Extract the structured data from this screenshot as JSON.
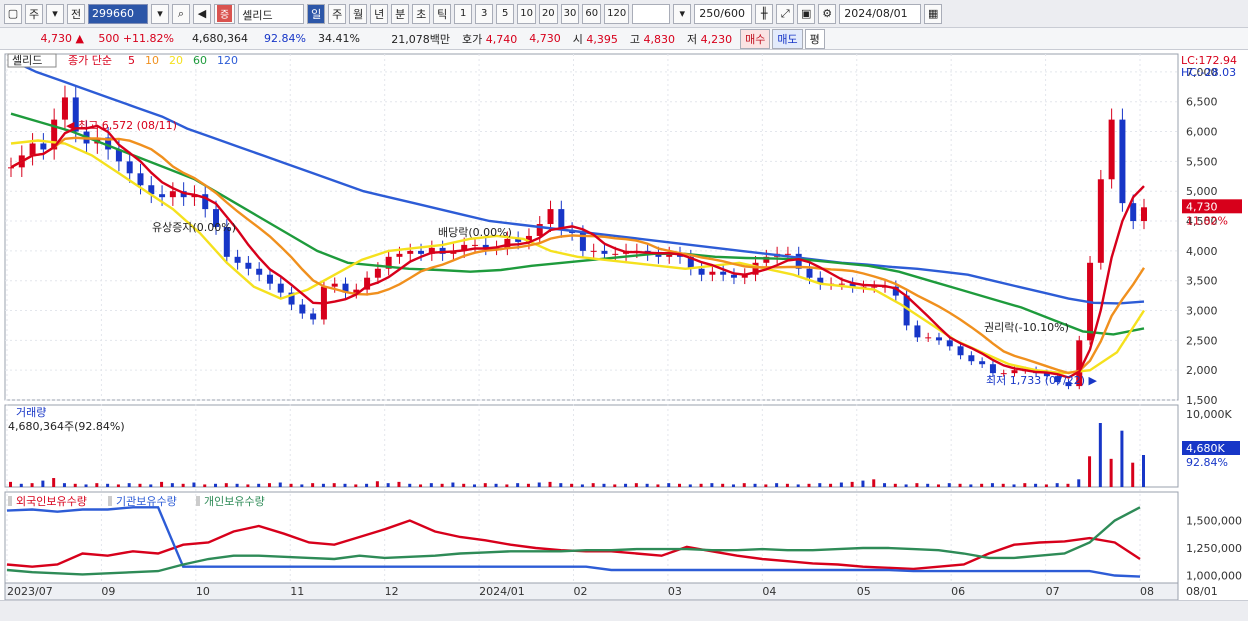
{
  "toolbar": {
    "type_label": "주",
    "prev_label": "전",
    "code": "299660",
    "tag": "증",
    "name": "셀리드",
    "periods": [
      "일",
      "주",
      "월",
      "년",
      "분",
      "초",
      "틱"
    ],
    "active_period": "일",
    "intervals": [
      "1",
      "3",
      "5",
      "10",
      "20",
      "30",
      "60",
      "120"
    ],
    "count": "250",
    "total": "/600",
    "date": "2024/08/01"
  },
  "quote": {
    "price": "4,730",
    "arrow": "▲",
    "change": "500",
    "change_pct": "+11.82%",
    "volume": "4,680,364",
    "vol_ratio": "92.84%",
    "turnover": "34.41%",
    "amount": "21,078백만",
    "ask_label": "호가",
    "ask": "4,740",
    "bid": "4,730",
    "open_label": "시",
    "open": "4,395",
    "high_label": "고",
    "high": "4,830",
    "low_label": "저",
    "low": "4,230",
    "buy_label": "매수",
    "sell_label": "매도",
    "eval_label": "평"
  },
  "legend": {
    "name": "셀리드",
    "close_label": "종가 단순",
    "ma_labels": [
      "5",
      "10",
      "20",
      "60",
      "120"
    ],
    "ma_colors": [
      "#d7001b",
      "#f0901e",
      "#f5e11e",
      "#1e9b3c",
      "#2d5cd6"
    ]
  },
  "right_header": {
    "lc": "LC:172.94",
    "hc": "HC:-28.03"
  },
  "price_badge": {
    "price": "4,730",
    "pct": "11.82%"
  },
  "annotations": {
    "high": "최고 6,572 (08/11)",
    "rights": "유상증자(0.00%)",
    "dividend": "배당락(0.00%)",
    "rights2": "권리락(-10.10%)",
    "low": "최저 1,733 (07/22)"
  },
  "volume_panel": {
    "title": "거래량",
    "value": "4,680,364주(92.84%)",
    "axis_label": "10,000K",
    "badge": "4,680K",
    "badge_pct": "92.84%"
  },
  "holdings_panel": {
    "labels": [
      "외국인보유수량",
      "기관보유수량",
      "개인보유수량"
    ],
    "colors": [
      "#d7001b",
      "#2d5cd6",
      "#2e8b57"
    ],
    "axis_labels": [
      "1,500,000",
      "1,250,000",
      "1,000,000"
    ]
  },
  "chart_data": {
    "type": "candlestick",
    "ylim": [
      1500,
      7300
    ],
    "y_ticks": [
      "7,000",
      "6,500",
      "6,000",
      "5,500",
      "5,000",
      "4,500",
      "4,000",
      "3,500",
      "3,000",
      "2,500",
      "2,000",
      "1,500"
    ],
    "x_ticks": [
      "2023/07",
      "09",
      "10",
      "11",
      "12",
      "2024/01",
      "02",
      "03",
      "04",
      "05",
      "06",
      "07",
      "08",
      "08/01"
    ],
    "close_series": [
      5400,
      5600,
      5800,
      5700,
      6200,
      6572,
      6000,
      5800,
      5900,
      5700,
      5500,
      5300,
      5100,
      4950,
      4900,
      5000,
      4900,
      4950,
      4700,
      4400,
      3900,
      3800,
      3700,
      3600,
      3450,
      3300,
      3100,
      2950,
      2850,
      3400,
      3450,
      3300,
      3350,
      3550,
      3700,
      3900,
      3950,
      4000,
      3950,
      4050,
      3950,
      4000,
      4100,
      4100,
      4050,
      4050,
      4200,
      4150,
      4250,
      4450,
      4700,
      4350,
      4300,
      4000,
      4000,
      3950,
      3950,
      4000,
      4000,
      3950,
      3900,
      3950,
      3900,
      3700,
      3600,
      3650,
      3600,
      3550,
      3600,
      3800,
      3900,
      3950,
      3950,
      3700,
      3550,
      3450,
      3450,
      3450,
      3400,
      3400,
      3400,
      3400,
      3250,
      2750,
      2550,
      2550,
      2500,
      2400,
      2250,
      2150,
      2100,
      1950,
      1950,
      2000,
      2000,
      1950,
      1900,
      1800,
      1733,
      2500,
      3800,
      5200,
      6200,
      4800,
      4500,
      4730
    ],
    "ma_windows": [
      5,
      10,
      20,
      60,
      120
    ],
    "ma120_series": [
      7200,
      7000,
      6850,
      6700,
      6550,
      6400,
      6250,
      6050,
      5900,
      5750,
      5600,
      5450,
      5300,
      5150,
      5000,
      4900,
      4800,
      4700,
      4600,
      4500,
      4450,
      4400,
      4350,
      4300,
      4250,
      4200,
      4150,
      4100,
      4050,
      4000,
      3950,
      3900,
      3850,
      3800,
      3770,
      3730,
      3700,
      3650,
      3600,
      3500,
      3400,
      3300,
      3200,
      3130,
      3120,
      3150
    ],
    "ma60_series": [
      6300,
      6150,
      6000,
      5800,
      5600,
      5400,
      5200,
      4900,
      4600,
      4300,
      4000,
      3800,
      3750,
      3700,
      3680,
      3650,
      3680,
      3750,
      3800,
      3850,
      3900,
      3950,
      3950,
      3900,
      3880,
      3870,
      3850,
      3800,
      3750,
      3650,
      3500,
      3350,
      3200,
      3050,
      2850,
      2650,
      2600,
      2700
    ],
    "ma20_series": [
      5800,
      5850,
      5800,
      5600,
      5300,
      5000,
      4700,
      4300,
      3800,
      3400,
      3200,
      3350,
      3600,
      3850,
      4000,
      4050,
      4100,
      4200,
      4250,
      4200,
      4000,
      3900,
      3850,
      3800,
      3750,
      3700,
      3750,
      3800,
      3700,
      3600,
      3450,
      3400,
      3350,
      3100,
      2800,
      2500,
      2300,
      2100,
      2000,
      1950,
      2000,
      2300,
      3000
    ],
    "volume_bars": [
      8,
      5,
      6,
      10,
      14,
      6,
      5,
      4,
      6,
      5,
      4,
      6,
      5,
      4,
      8,
      6,
      5,
      7,
      4,
      5,
      6,
      5,
      4,
      5,
      6,
      7,
      5,
      4,
      6,
      5,
      6,
      5,
      4,
      5,
      9,
      6,
      8,
      5,
      4,
      6,
      5,
      7,
      5,
      4,
      6,
      5,
      4,
      6,
      5,
      7,
      8,
      6,
      5,
      4,
      6,
      5,
      4,
      5,
      6,
      5,
      4,
      6,
      5,
      4,
      5,
      6,
      5,
      4,
      6,
      5,
      4,
      6,
      5,
      4,
      5,
      6,
      5,
      7,
      8,
      10,
      12,
      6,
      5,
      4,
      6,
      5,
      4,
      6,
      5,
      4,
      5,
      6,
      5,
      4,
      6,
      5,
      4,
      6,
      5,
      12,
      48,
      100,
      44,
      88,
      38,
      50
    ],
    "vol_ylim": [
      0,
      10000
    ],
    "foreign_series": [
      1100000,
      1080000,
      1100000,
      1200000,
      1180000,
      1220000,
      1200000,
      1280000,
      1300000,
      1400000,
      1450000,
      1380000,
      1300000,
      1280000,
      1350000,
      1420000,
      1500000,
      1400000,
      1350000,
      1320000,
      1280000,
      1250000,
      1230000,
      1220000,
      1220000,
      1200000,
      1180000,
      1260000,
      1220000,
      1180000,
      1150000,
      1130000,
      1110000,
      1100000,
      1080000,
      1070000,
      1060000,
      1080000,
      1100000,
      1200000,
      1280000,
      1300000,
      1310000,
      1340000,
      1300000,
      1150000
    ],
    "institution_series": [
      1590000,
      1600000,
      1580000,
      1600000,
      1600000,
      1620000,
      1620000,
      1080000,
      1080000,
      1080000,
      1080000,
      1080000,
      1080000,
      1080000,
      1080000,
      1080000,
      1080000,
      1080000,
      1080000,
      1080000,
      1080000,
      1080000,
      1080000,
      1080000,
      1050000,
      1050000,
      1050000,
      1050000,
      1050000,
      1050000,
      1050000,
      1050000,
      1050000,
      1050000,
      1050000,
      1050000,
      1040000,
      1040000,
      1040000,
      1040000,
      1040000,
      1040000,
      1040000,
      1040000,
      1000000,
      990000
    ],
    "individual_series": [
      1050000,
      1030000,
      1020000,
      1010000,
      1020000,
      1030000,
      1040000,
      1100000,
      1150000,
      1180000,
      1180000,
      1170000,
      1160000,
      1150000,
      1180000,
      1160000,
      1170000,
      1180000,
      1200000,
      1210000,
      1220000,
      1220000,
      1220000,
      1230000,
      1230000,
      1240000,
      1240000,
      1240000,
      1230000,
      1230000,
      1240000,
      1230000,
      1230000,
      1240000,
      1250000,
      1250000,
      1240000,
      1230000,
      1200000,
      1160000,
      1160000,
      1180000,
      1200000,
      1300000,
      1500000,
      1620000
    ],
    "holdings_ylim": [
      950000,
      1650000
    ]
  }
}
